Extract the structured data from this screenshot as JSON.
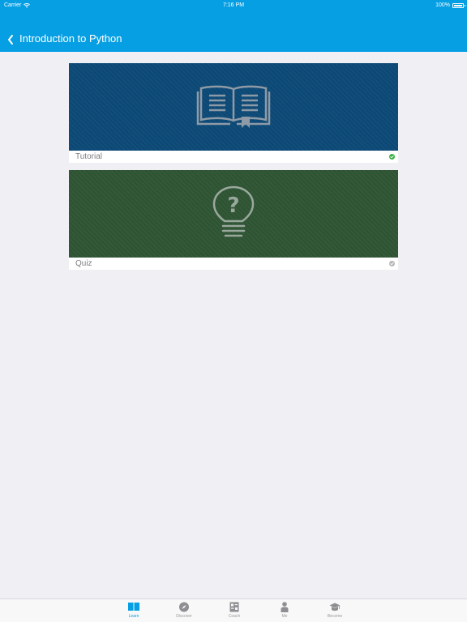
{
  "status_bar": {
    "carrier": "Carrier",
    "time": "7:16 PM",
    "battery": "100%"
  },
  "nav": {
    "title": "Introduction to Python",
    "back_icon": "chevron-left-icon"
  },
  "cards": [
    {
      "label": "Tutorial",
      "icon": "open-book-icon",
      "status": "completed",
      "status_color": "#3cb043",
      "bg": "#0d4a78"
    },
    {
      "label": "Quiz",
      "icon": "lightbulb-question-icon",
      "status": "incomplete",
      "status_color": "#b5b5b5",
      "bg": "#2f5635"
    }
  ],
  "tabs": [
    {
      "label": "Learn",
      "icon": "book-icon",
      "active": true
    },
    {
      "label": "Discover",
      "icon": "compass-icon",
      "active": false
    },
    {
      "label": "Coach",
      "icon": "grid-icon",
      "active": false
    },
    {
      "label": "Me",
      "icon": "person-icon",
      "active": false
    },
    {
      "label": "Become",
      "icon": "graduation-cap-icon",
      "active": false
    }
  ],
  "colors": {
    "accent": "#079fe3",
    "background": "#efeff4",
    "tab_inactive": "#999999"
  }
}
